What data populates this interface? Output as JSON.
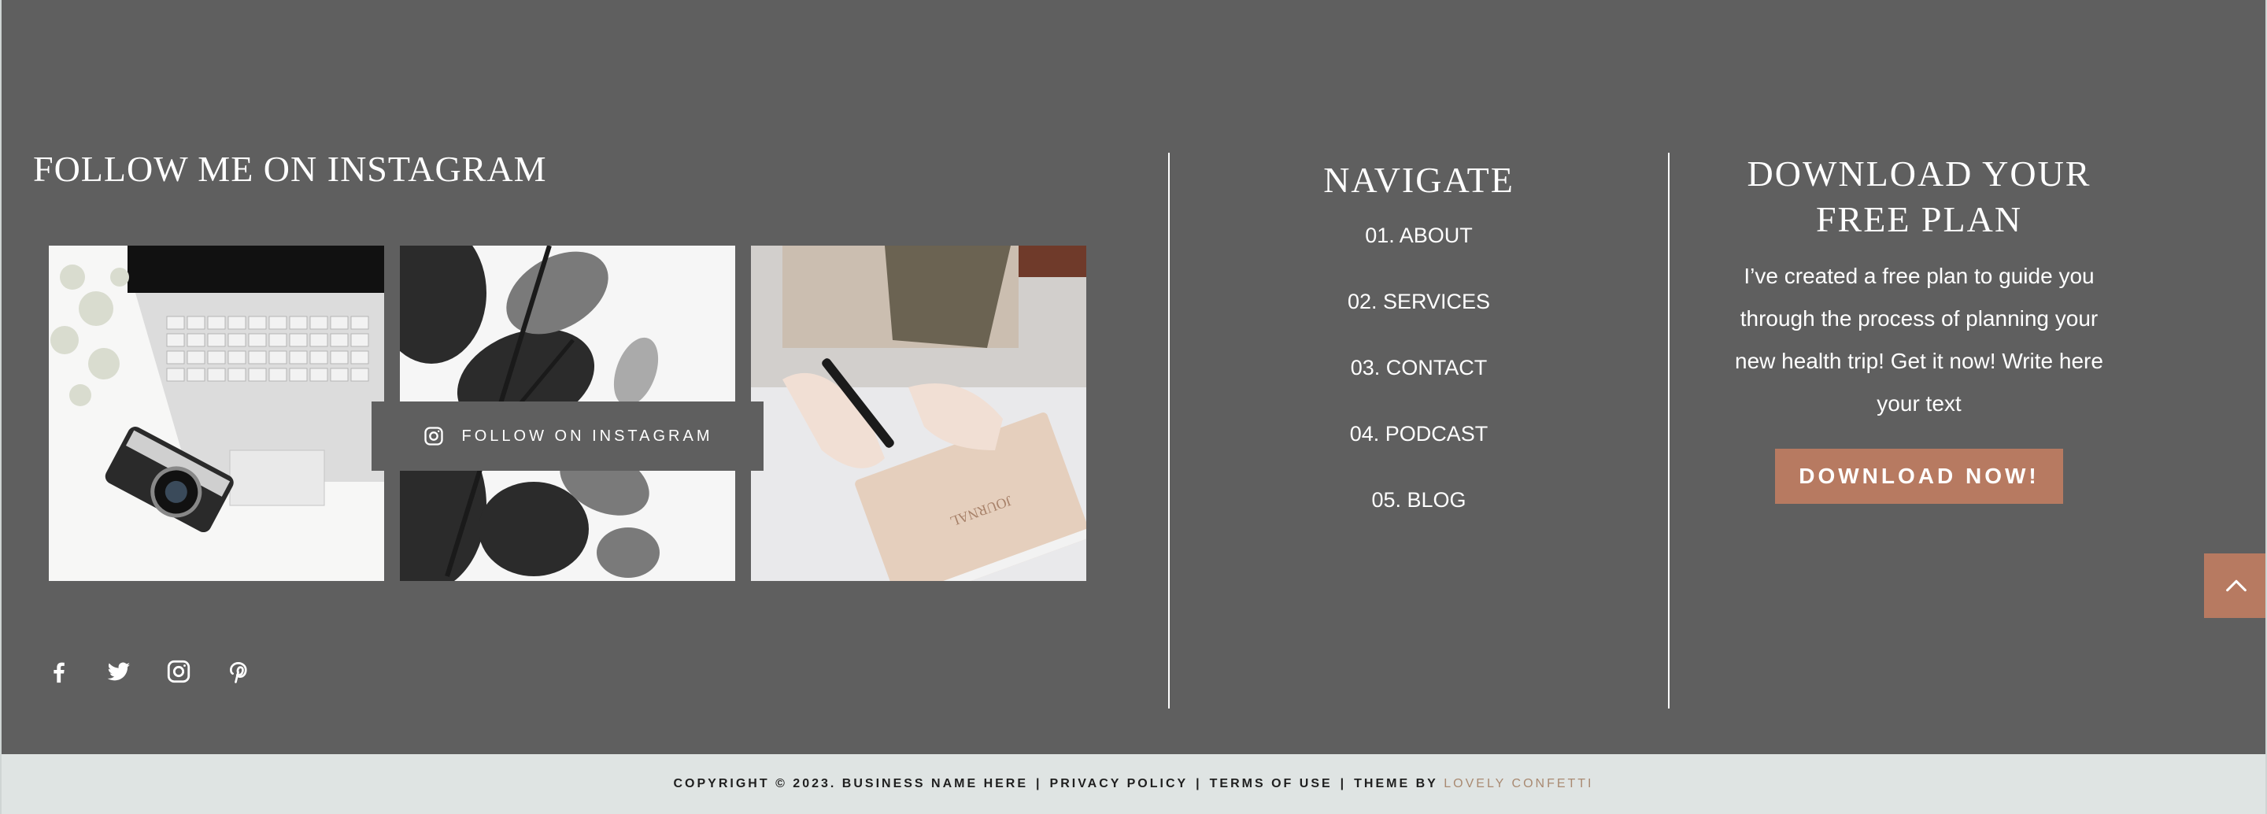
{
  "instagram": {
    "title": "FOLLOW ME ON INSTAGRAM",
    "follow_button_label": "FOLLOW ON INSTAGRAM"
  },
  "navigate": {
    "title": "NAVIGATE",
    "items": [
      {
        "label": "01. ABOUT"
      },
      {
        "label": "02. SERVICES"
      },
      {
        "label": "03. CONTACT"
      },
      {
        "label": "04. PODCAST"
      },
      {
        "label": "05. BLOG"
      }
    ]
  },
  "download": {
    "title": "DOWNLOAD YOUR FREE PLAN",
    "description": "I’ve created a free plan to guide you through the process of planning your new health trip! Get it now! Write here your text",
    "button_label": "DOWNLOAD NOW!"
  },
  "social_icons": [
    "facebook-icon",
    "twitter-icon",
    "instagram-icon",
    "pinterest-icon"
  ],
  "footer": {
    "copyright": "COPYRIGHT © 2023. BUSINESS NAME HERE",
    "privacy": "PRIVACY POLICY",
    "terms": "TERMS OF USE",
    "theme_by": "THEME BY",
    "theme_author": "LOVELY CONFETTI",
    "separator": "|"
  },
  "colors": {
    "background": "#5f5f5f",
    "accent": "#b77a61",
    "bottom_bar": "#dfe4e3",
    "brand_link": "#a98a72"
  }
}
